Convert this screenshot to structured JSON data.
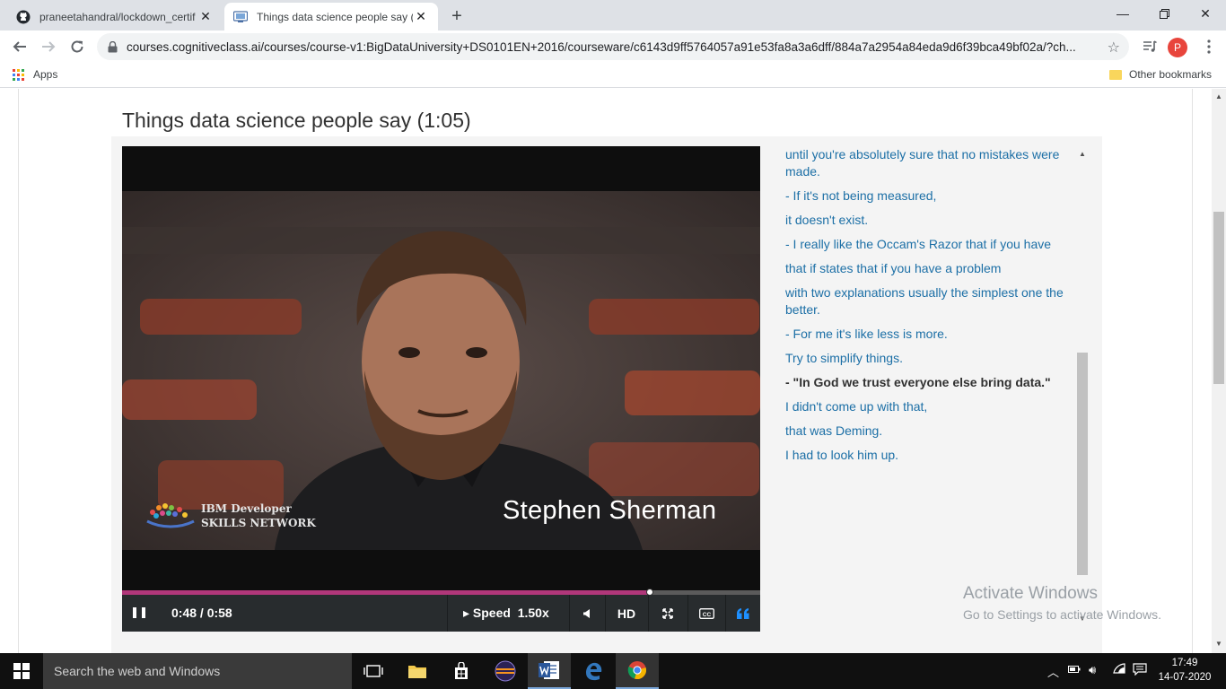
{
  "browser": {
    "tabs": [
      {
        "title": "praneetahandral/lockdown_certif",
        "active": false
      },
      {
        "title": "Things data science people say (",
        "active": true
      }
    ],
    "url": "courses.cognitiveclass.ai/courses/course-v1:BigDataUniversity+DS0101EN+2016/courseware/c6143d9ff5764057a91e53fa8a3a6dff/884a7a2954a84eda9d6f39bca49bf02a/?ch...",
    "profile_initial": "P",
    "bookmarks": {
      "apps_label": "Apps",
      "other_label": "Other bookmarks"
    }
  },
  "page": {
    "title": "Things data science people say (1:05)",
    "video": {
      "speaker_name": "Stephen Sherman",
      "logo_text": [
        "IBM Developer",
        "SKILLS NETWORK"
      ],
      "time": "0:48 / 0:58",
      "progress": 0.827,
      "speed_label": "Speed",
      "speed_value": "1.50x",
      "hd_label": "HD",
      "cc_label": "CC"
    },
    "transcript": [
      {
        "text": "until you're absolutely sure that no mistakes were made.",
        "current": false
      },
      {
        "text": "- If it's not being measured,",
        "current": false
      },
      {
        "text": "it doesn't exist.",
        "current": false
      },
      {
        "text": "- I really like the Occam's Razor that if you have",
        "current": false
      },
      {
        "text": "that if states that if you have a problem",
        "current": false
      },
      {
        "text": "with two explanations usually the simplest one the better.",
        "current": false
      },
      {
        "text": "- For me it's like less is more.",
        "current": false
      },
      {
        "text": "Try to simplify things.",
        "current": false
      },
      {
        "text": "- \"In God we trust everyone else bring data.\"",
        "current": true
      },
      {
        "text": "I didn't come up with that,",
        "current": false
      },
      {
        "text": "that was Deming.",
        "current": false
      },
      {
        "text": "I had to look him up.",
        "current": false
      }
    ]
  },
  "watermark": {
    "line1": "Activate Windows",
    "line2": "Go to Settings to activate Windows."
  },
  "taskbar": {
    "search_placeholder": "Search the web and Windows",
    "time": "17:49",
    "date": "14-07-2020"
  },
  "colors": {
    "link": "#1c6fa6",
    "progress": "#b1377a",
    "controls_bg": "#282c2e"
  }
}
